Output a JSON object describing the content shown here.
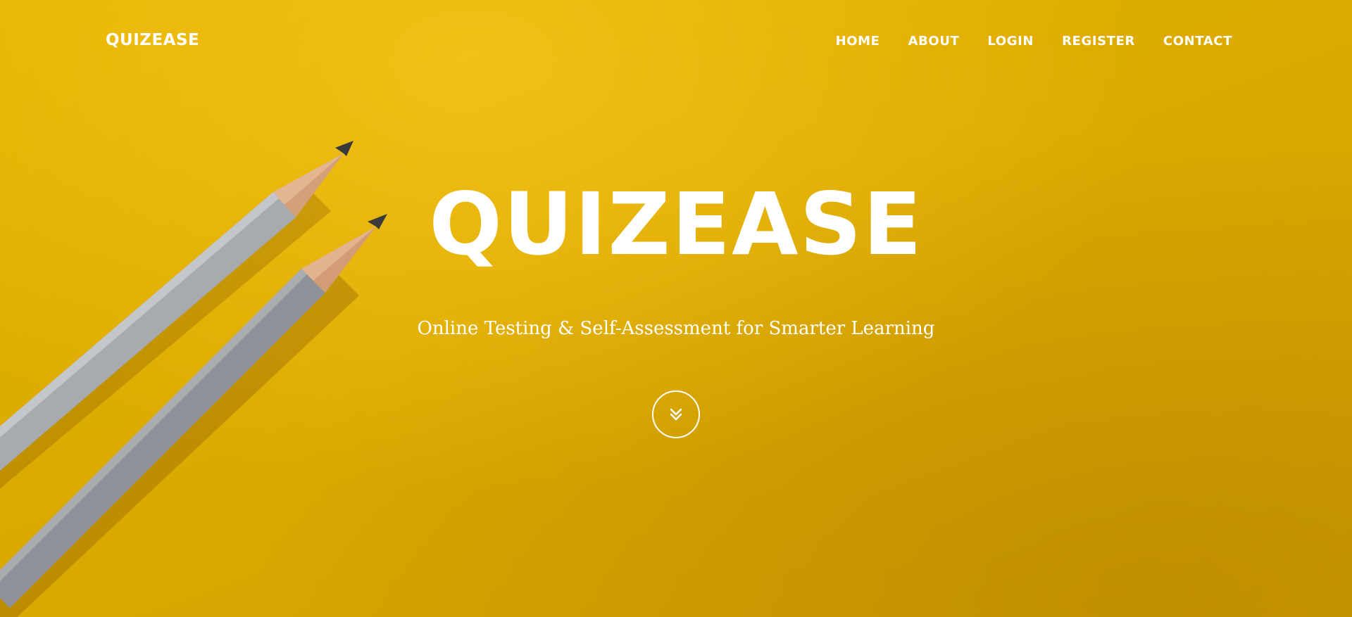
{
  "navbar": {
    "brand": "QUIZEASE",
    "links": [
      "HOME",
      "ABOUT",
      "LOGIN",
      "REGISTER",
      "CONTACT"
    ]
  },
  "hero": {
    "title": "QUIZEASE",
    "subtitle": "Online Testing & Self-Assessment for Smarter Learning",
    "scroll_icon": "double-chevron-down-icon"
  },
  "colors": {
    "background": "#dfac00",
    "text": "#ffffff",
    "pencil_body": "#9a9ea3",
    "pencil_wood": "#d9a07a",
    "pencil_lead": "#333333"
  }
}
